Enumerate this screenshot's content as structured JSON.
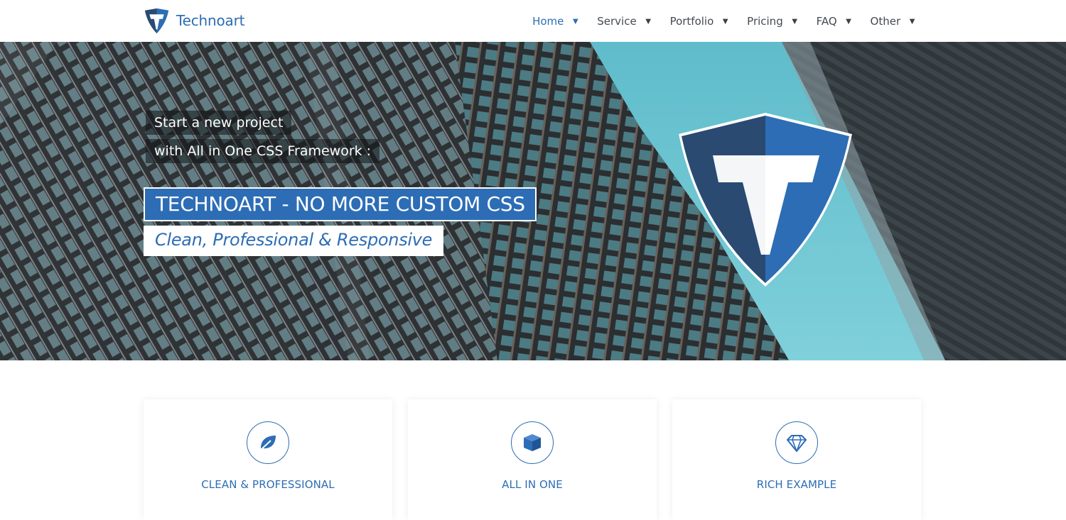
{
  "brand": {
    "name": "Technoart",
    "logo_icon": "shield-t-logo-icon"
  },
  "nav": {
    "items": [
      {
        "label": "Home",
        "caret": "▼",
        "active": true
      },
      {
        "label": "Service",
        "caret": "▼"
      },
      {
        "label": "Portfolio",
        "caret": "▼"
      },
      {
        "label": "Pricing",
        "caret": "▼"
      },
      {
        "label": "FAQ",
        "caret": "▼"
      },
      {
        "label": "Other",
        "caret": "▼"
      }
    ]
  },
  "hero": {
    "kicker_line1": "Start a new project",
    "kicker_line2": "with All in One CSS Framework :",
    "title": "TECHNOART - NO MORE CUSTOM CSS",
    "subtitle": "Clean, Professional & Responsive",
    "background": "architecture-photo",
    "emblem": "shield-t-logo-icon"
  },
  "features": [
    {
      "title": "CLEAN & PROFESSIONAL",
      "icon": "leaf-icon"
    },
    {
      "title": "ALL IN ONE",
      "icon": "cube-icon"
    },
    {
      "title": "RICH EXAMPLE",
      "icon": "diamond-icon"
    }
  ],
  "colors": {
    "accent": "#2d6db5",
    "accent_dark": "#2a4a72",
    "sky": "#6fc3cf",
    "text": "#444a52"
  }
}
